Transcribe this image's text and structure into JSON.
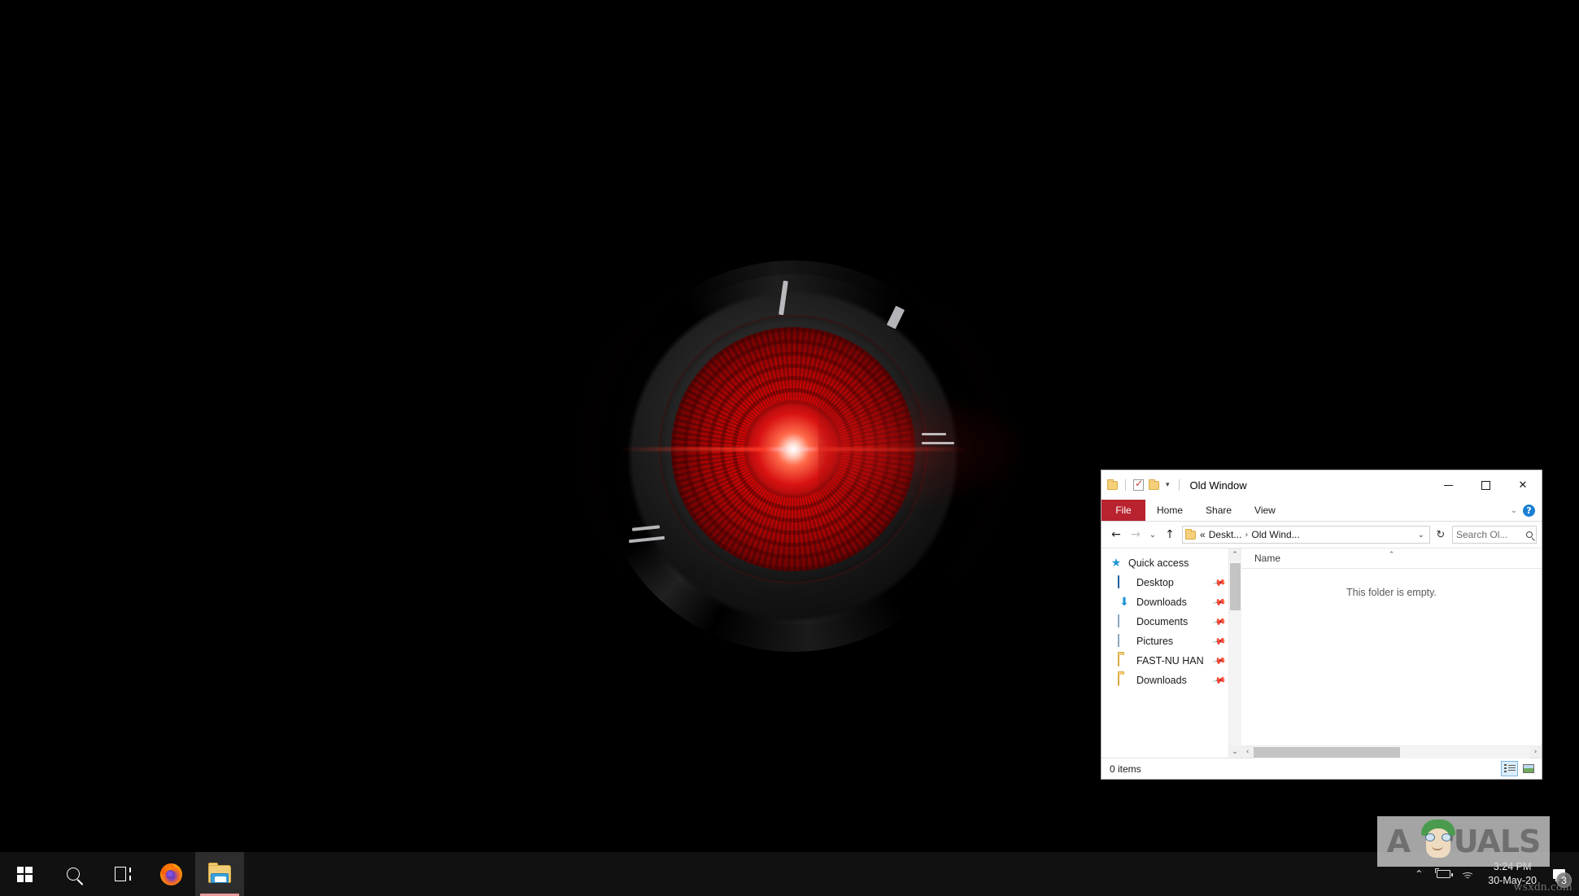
{
  "desktop": {
    "wallpaper_name": "red-sci-fi-eye-wallpaper",
    "background_color": "#000000"
  },
  "explorer_window": {
    "title": "Old Window",
    "quick_access_toolbar": [
      {
        "name": "folder-icon",
        "label": ""
      },
      {
        "name": "properties-icon",
        "label": ""
      },
      {
        "name": "new-folder-icon",
        "label": ""
      },
      {
        "name": "customize-qat-caret",
        "label": "▾"
      }
    ],
    "window_controls": {
      "minimize": "—",
      "maximize": "▢",
      "close": "✕"
    },
    "ribbon": {
      "file_tab": "File",
      "tabs": [
        "Home",
        "Share",
        "View"
      ],
      "expand_caret": "⌄",
      "help": "?",
      "accent_color": "#b8232f"
    },
    "address_bar": {
      "back": "←",
      "forward": "→",
      "recent_locations": "⌄",
      "up": "↑",
      "breadcrumb_prefix": "«",
      "crumbs": [
        "Deskt...",
        "Old Wind..."
      ],
      "crumb_separator": "›",
      "dropdown": "⌄",
      "refresh": "↻",
      "search_placeholder": "Search Ol..."
    },
    "nav_pane": {
      "items": [
        {
          "label": "Quick access",
          "icon": "star-pin-icon",
          "pinned": false,
          "level": 1
        },
        {
          "label": "Desktop",
          "icon": "desktop-icon",
          "pinned": true,
          "level": 2
        },
        {
          "label": "Downloads",
          "icon": "downloads-arrow-icon",
          "pinned": true,
          "level": 2
        },
        {
          "label": "Documents",
          "icon": "documents-icon",
          "pinned": true,
          "level": 2
        },
        {
          "label": "Pictures",
          "icon": "pictures-icon",
          "pinned": true,
          "level": 2
        },
        {
          "label": "FAST-NU HAN",
          "icon": "folder-icon",
          "pinned": true,
          "level": 2
        },
        {
          "label": "Downloads",
          "icon": "folder-icon",
          "pinned": true,
          "level": 2
        }
      ],
      "pin_glyph": "📌",
      "scroll_up": "⌃",
      "scroll_down": "⌄"
    },
    "file_list": {
      "columns": [
        "Name"
      ],
      "sort_indicator": "⌃",
      "empty_message": "This folder is empty.",
      "rows": []
    },
    "hscroll": {
      "left": "‹",
      "right": "›"
    },
    "status_bar": {
      "item_count": "0 items",
      "views": [
        {
          "name": "details-view-button",
          "active": true
        },
        {
          "name": "large-icons-view-button",
          "active": false
        }
      ]
    }
  },
  "taskbar": {
    "items": [
      {
        "name": "start-button",
        "label": "Start",
        "active": false
      },
      {
        "name": "search-button",
        "label": "Search",
        "active": false
      },
      {
        "name": "task-view-button",
        "label": "Task View",
        "active": false
      },
      {
        "name": "firefox-taskbar-button",
        "label": "Firefox",
        "active": false
      },
      {
        "name": "file-explorer-taskbar-button",
        "label": "File Explorer",
        "active": true
      }
    ],
    "tray": {
      "show_hidden": "⌃",
      "battery": "battery-icon",
      "network": "wifi-icon",
      "time": "3:24 PM",
      "date": "30-May-20",
      "action_center_badge": "3"
    }
  },
  "watermarks": {
    "appuals": "PUALS",
    "appuals_prefix": "A",
    "source": "wsxdn.com"
  }
}
